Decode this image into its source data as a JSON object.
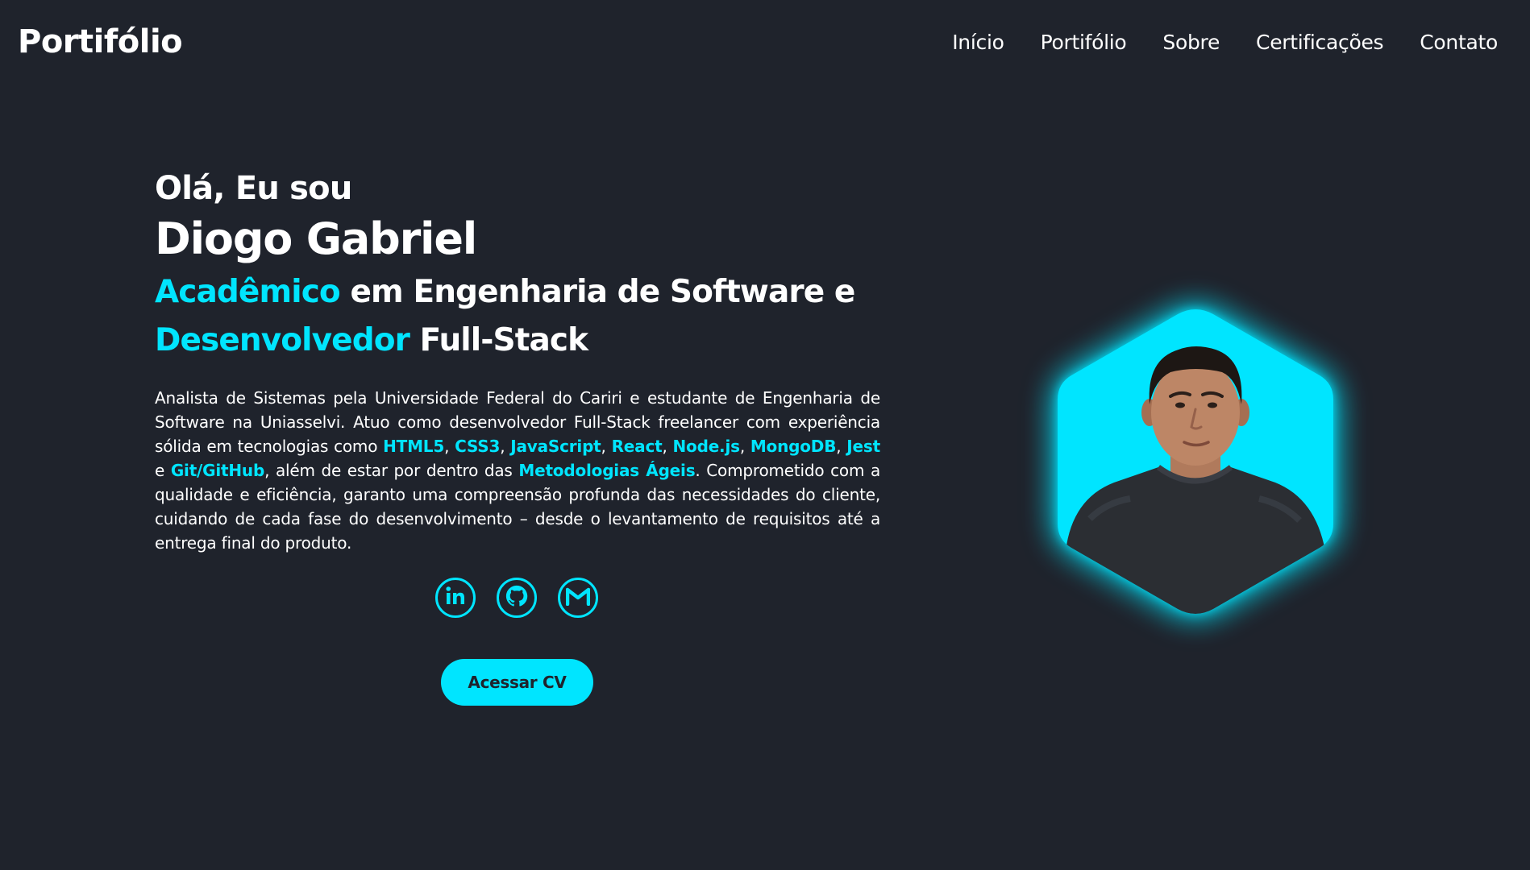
{
  "header": {
    "logo": "Portifólio",
    "nav": [
      "Início",
      "Portifólio",
      "Sobre",
      "Certificações",
      "Contato"
    ]
  },
  "hero": {
    "greeting": "Olá, Eu sou",
    "name": "Diogo Gabriel",
    "role_line1_accent": "Acadêmico",
    "role_line1_rest": " em Engenharia de Software e",
    "role_line2_accent": "Desenvolvedor",
    "role_line2_rest": " Full-Stack",
    "about": {
      "p1": "Analista de Sistemas pela Universidade Federal do Cariri e estudante de Engenharia de Software na Uniasselvi. Atuo como desenvolvedor Full-Stack freelancer com experiência sólida em tecnologias como ",
      "techs": [
        "HTML5",
        "CSS3",
        "JavaScript",
        "React",
        "Node.js",
        "MongoDB",
        "Jest"
      ],
      "sep": ", ",
      "and": " e ",
      "git": "Git/GitHub",
      "p2": ", além de estar por dentro das ",
      "agile": "Metodologias Ágeis",
      "p3": ". Comprometido com a qualidade e eficiência, garanto uma compreensão profunda das necessidades do cliente, cuidando de cada fase do desenvolvimento – desde o levantamento de requisitos até a entrega final do produto."
    },
    "socials": [
      {
        "icon": "linkedin-icon"
      },
      {
        "icon": "github-icon"
      },
      {
        "icon": "gmail-icon"
      }
    ],
    "cv_button": "Acessar CV"
  },
  "colors": {
    "background": "#1f232c",
    "accent": "#00e5ff",
    "text": "#ffffff"
  }
}
